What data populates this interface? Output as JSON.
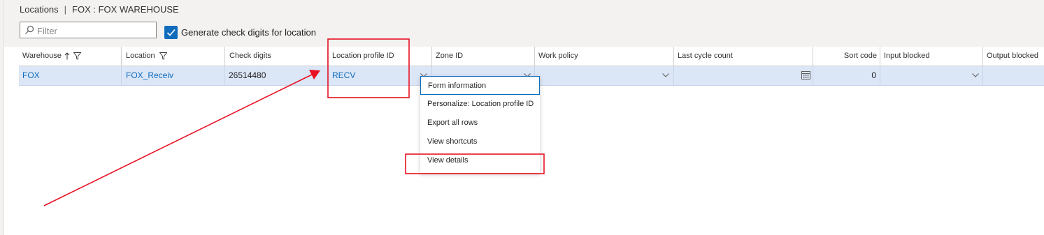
{
  "breadcrumb": {
    "section": "Locations",
    "separator": "|",
    "context": "FOX : FOX WAREHOUSE"
  },
  "filter": {
    "placeholder": "Filter",
    "value": ""
  },
  "options": {
    "generate_check_digits_label": "Generate check digits for location",
    "generate_check_digits_checked": true
  },
  "grid": {
    "columns": {
      "warehouse": "Warehouse",
      "location": "Location",
      "check_digits": "Check digits",
      "location_profile_id": "Location profile ID",
      "zone_id": "Zone ID",
      "work_policy": "Work policy",
      "last_cycle_count": "Last cycle count",
      "sort_code": "Sort code",
      "input_blocked": "Input blocked",
      "output_blocked": "Output blocked"
    },
    "row": {
      "warehouse": "FOX",
      "location": "FOX_Receiv",
      "check_digits": "26514480",
      "location_profile_id": "RECV",
      "zone_id": "",
      "work_policy": "",
      "last_cycle_count": "",
      "sort_code": "0",
      "input_blocked": "",
      "output_blocked": ""
    },
    "sort": {
      "column": "Warehouse",
      "direction": "ascending"
    }
  },
  "context_menu": {
    "items": [
      "Form information",
      "Personalize: Location profile ID",
      "Export all rows",
      "View shortcuts",
      "View details"
    ]
  },
  "colors": {
    "accent": "#0f6cbd",
    "selected_row": "#dbe6f7",
    "annotation": "#e81123"
  }
}
